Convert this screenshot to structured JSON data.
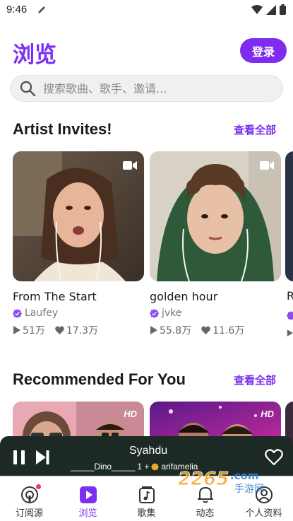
{
  "status_bar": {
    "time": "9:46"
  },
  "header": {
    "title": "浏览",
    "login_label": "登录"
  },
  "search": {
    "placeholder": "搜索歌曲、歌手、邀请..."
  },
  "artist_invites": {
    "title": "Artist Invites!",
    "see_all": "查看全部",
    "cards": [
      {
        "title": "From The Start",
        "artist": "Laufey",
        "plays": "51万",
        "likes": "17.3万"
      },
      {
        "title": "golden hour",
        "artist": "jvke",
        "plays": "55.8万",
        "likes": "11.6万"
      },
      {
        "title": "R",
        "artist": "",
        "plays": "",
        "likes": ""
      }
    ]
  },
  "recommended": {
    "title": "Recommended For You",
    "see_all": "查看全部",
    "badges": [
      "HD",
      "HD"
    ]
  },
  "player": {
    "title": "Syahdu",
    "artist_a": "_____Dino_____",
    "separator": "1 +",
    "artist_b": "arifamelia",
    "progress_fraction": 0.0
  },
  "bottom_nav": {
    "items": [
      {
        "label": "订阅源",
        "icon": "podcast-icon"
      },
      {
        "label": "浏览",
        "icon": "play-icon"
      },
      {
        "label": "歌集",
        "icon": "songbook-icon"
      },
      {
        "label": "动态",
        "icon": "bell-icon"
      },
      {
        "label": "个人资料",
        "icon": "profile-icon"
      }
    ]
  },
  "watermark": {
    "text": "2265.com 手游网"
  },
  "colors": {
    "accent": "#7b2ff0",
    "player_bg": "#1c2925"
  }
}
